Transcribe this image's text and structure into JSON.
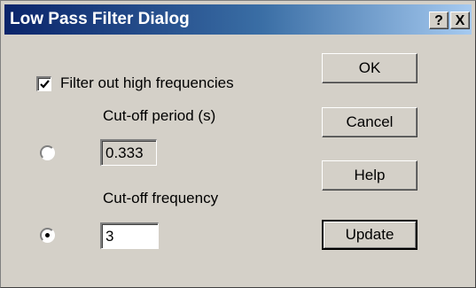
{
  "window": {
    "title": "Low Pass Filter Dialog",
    "help_glyph": "?",
    "close_glyph": "X"
  },
  "filter_checkbox": {
    "label": "Filter out high frequencies",
    "checked": true
  },
  "cutoff_period": {
    "label": "Cut-off period (s)",
    "value": "0.333",
    "selected": false
  },
  "cutoff_frequency": {
    "label": "Cut-off frequency",
    "value": "3",
    "selected": true
  },
  "buttons": {
    "ok": "OK",
    "cancel": "Cancel",
    "help": "Help",
    "update": "Update"
  },
  "colors": {
    "face": "#d4d0c8",
    "title_start": "#0a246a",
    "title_end": "#a6caf0"
  }
}
